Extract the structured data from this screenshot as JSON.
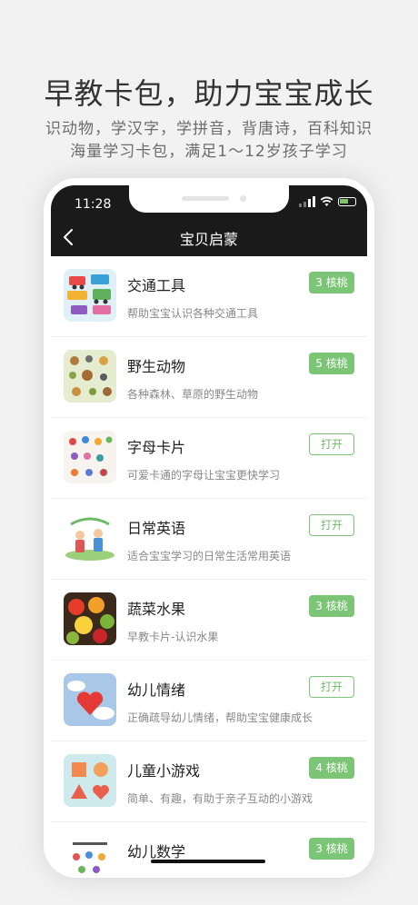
{
  "promo": {
    "title": "早教卡包，助力宝宝成长",
    "line1": "识动物，学汉字，学拼音，背唐诗，百科知识",
    "line2": "海量学习卡包，满足1～12岁孩子学习"
  },
  "status_bar": {
    "time": "11:28"
  },
  "nav": {
    "back_icon": "chevron-left-icon",
    "title": "宝贝启蒙"
  },
  "items": [
    {
      "title": "交通工具",
      "desc": "帮助宝宝认识各种交通工具",
      "button": "3 核桃",
      "button_type": "price"
    },
    {
      "title": "野生动物",
      "desc": "各种森林、草原的野生动物",
      "button": "5 核桃",
      "button_type": "price"
    },
    {
      "title": "字母卡片",
      "desc": "可爱卡通的字母让宝宝更快学习",
      "button": "打开",
      "button_type": "open"
    },
    {
      "title": "日常英语",
      "desc": "适合宝宝学习的日常生活常用英语",
      "button": "打开",
      "button_type": "open"
    },
    {
      "title": "蔬菜水果",
      "desc": "早教卡片-认识水果",
      "button": "3 核桃",
      "button_type": "price"
    },
    {
      "title": "幼儿情绪",
      "desc": "正确疏导幼儿情绪，帮助宝宝健康成长",
      "button": "打开",
      "button_type": "open"
    },
    {
      "title": "儿童小游戏",
      "desc": "简单、有趣，有助于亲子互动的小游戏",
      "button": "4 核桃",
      "button_type": "price"
    },
    {
      "title": "幼儿数学",
      "desc": "",
      "button": "3 核桃",
      "button_type": "price"
    }
  ],
  "colors": {
    "accent": "#7cc576",
    "nav_bg": "#1a1a1a"
  }
}
